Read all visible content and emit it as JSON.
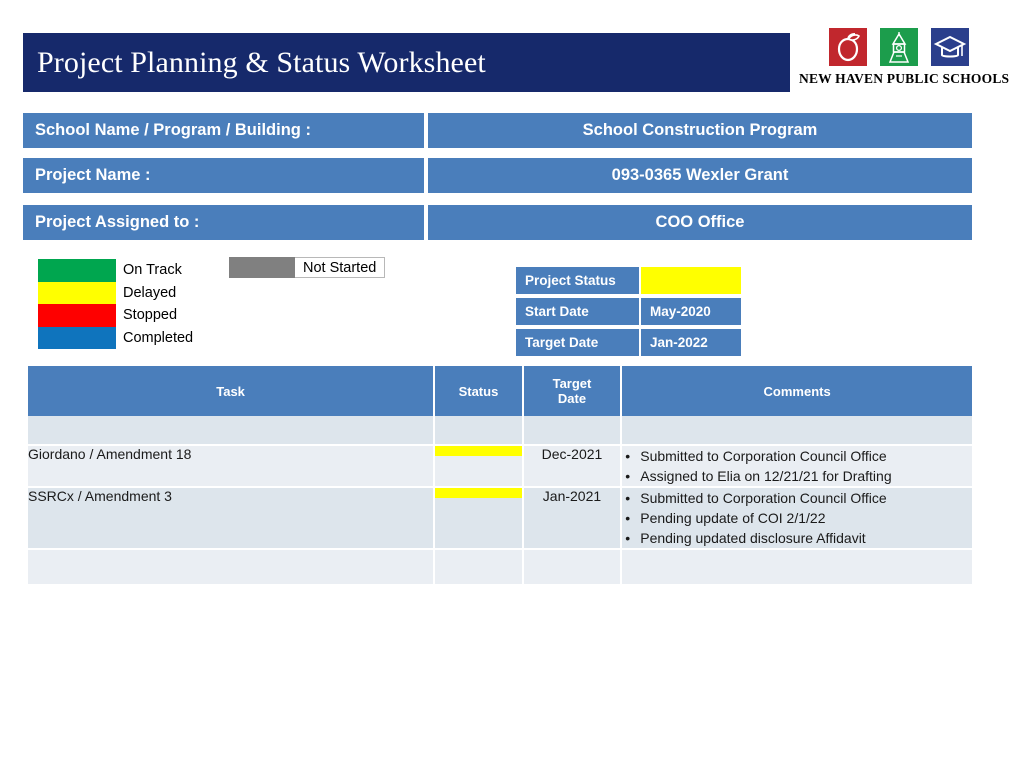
{
  "header": {
    "title": "Project Planning & Status Worksheet",
    "title_bg": "#16296b"
  },
  "logo": {
    "caption": "NEW HAVEN PUBLIC SCHOOLS",
    "marks": [
      {
        "name": "apple-icon",
        "color": "#c1272d"
      },
      {
        "name": "steeple-icon",
        "color": "#1c9d4c"
      },
      {
        "name": "graduation-cap-icon",
        "color": "#2b3f8c"
      }
    ]
  },
  "info_rows": [
    {
      "label": "School Name / Program / Building :",
      "value": "School Construction Program"
    },
    {
      "label": "Project Name :",
      "value": "093-0365 Wexler Grant"
    },
    {
      "label": "Project Assigned to :",
      "value": "COO Office"
    }
  ],
  "legend": {
    "items": [
      {
        "label": "On Track",
        "color": "#00a64f"
      },
      {
        "label": "Delayed",
        "color": "#ffff00"
      },
      {
        "label": "Stopped",
        "color": "#fe0000"
      },
      {
        "label": "Completed",
        "color": "#0f74bd"
      }
    ],
    "not_started": {
      "label": "Not Started",
      "color": "#808080"
    }
  },
  "status_summary": [
    {
      "key": "Project Status",
      "value": "",
      "highlight": true
    },
    {
      "key": "Start Date",
      "value": "May-2020",
      "highlight": false
    },
    {
      "key": "Target  Date",
      "value": "Jan-2022",
      "highlight": false
    }
  ],
  "task_table": {
    "columns": [
      "Task",
      "Status",
      "Target\nDate",
      "Comments"
    ],
    "column_headers": {
      "task": "Task",
      "status": "Status",
      "target_date_line1": "Target",
      "target_date_line2": "Date",
      "comments": "Comments"
    },
    "rows": [
      {
        "task": "",
        "status": "",
        "target_date": "",
        "comments": []
      },
      {
        "task": "Giordano / Amendment 18",
        "status": "delayed",
        "target_date": "Dec-2021",
        "comments": [
          "Submitted to Corporation Council Office",
          "Assigned to Elia on 12/21/21 for Drafting"
        ]
      },
      {
        "task": "SSRCx  / Amendment 3",
        "status": "delayed",
        "target_date": "Jan-2021",
        "comments": [
          "Submitted to Corporation Council Office",
          "Pending update of COI 2/1/22",
          "Pending updated disclosure Affidavit"
        ]
      },
      {
        "task": "",
        "status": "",
        "target_date": "",
        "comments": []
      }
    ]
  },
  "colors": {
    "brand_blue": "#4a7ebb",
    "navy": "#16296b",
    "band_a": "#dde5ec",
    "band_b": "#eaeef3",
    "delayed": "#ffff00"
  }
}
